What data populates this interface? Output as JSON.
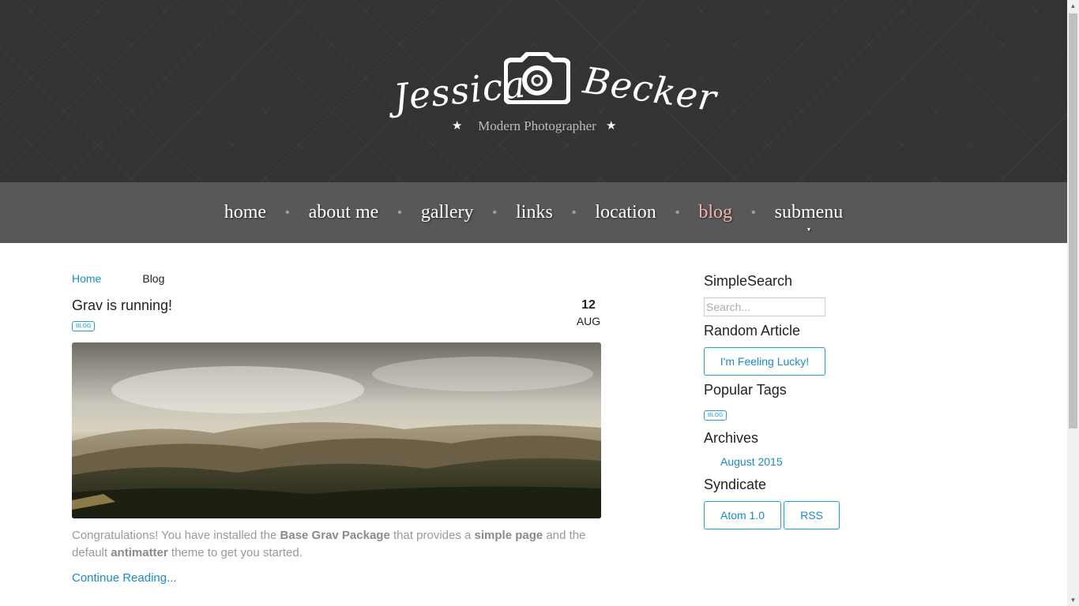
{
  "header": {
    "logo_first": "Jessica",
    "logo_last": "Becker",
    "tagline": "Modern Photographer",
    "star": "★"
  },
  "nav": {
    "items": [
      {
        "label": "home"
      },
      {
        "label": "about me"
      },
      {
        "label": "gallery"
      },
      {
        "label": "links"
      },
      {
        "label": "location"
      },
      {
        "label": "blog",
        "active": true
      },
      {
        "label": "submenu",
        "has_dropdown": true
      }
    ],
    "separator": "•",
    "caret": "▼"
  },
  "breadcrumb": {
    "home": "Home",
    "current": "Blog"
  },
  "post": {
    "title": "Grav is running!",
    "tag": "BLOG",
    "date_day": "12",
    "date_month": "AUG",
    "excerpt_1": "Congratulations! You have installed the ",
    "excerpt_b1": "Base Grav Package",
    "excerpt_2": " that provides a ",
    "excerpt_b2": "simple page",
    "excerpt_3": " and the default ",
    "excerpt_b3": "antimatter",
    "excerpt_4": " theme to get you started.",
    "continue": "Continue Reading..."
  },
  "sidebar": {
    "search_title": "SimpleSearch",
    "search_placeholder": "Search...",
    "random_title": "Random Article",
    "random_button": "I'm Feeling Lucky!",
    "tags_title": "Popular Tags",
    "tag": "BLOG",
    "archives_title": "Archives",
    "archive_link": "August 2015",
    "syndicate_title": "Syndicate",
    "atom_button": "Atom 1.0",
    "rss_button": "RSS"
  },
  "colors": {
    "header_bg": "#333335",
    "nav_bg": "#58585a",
    "accent": "#1b8ac9",
    "nav_active": "#f2b3b3"
  },
  "icons": {
    "logo": "camera-icon",
    "tagline_marks": "star-icon",
    "submenu": "caret-down-icon",
    "scroll_up": "scroll-up-arrow-icon",
    "scroll_down": "scroll-down-arrow-icon"
  }
}
